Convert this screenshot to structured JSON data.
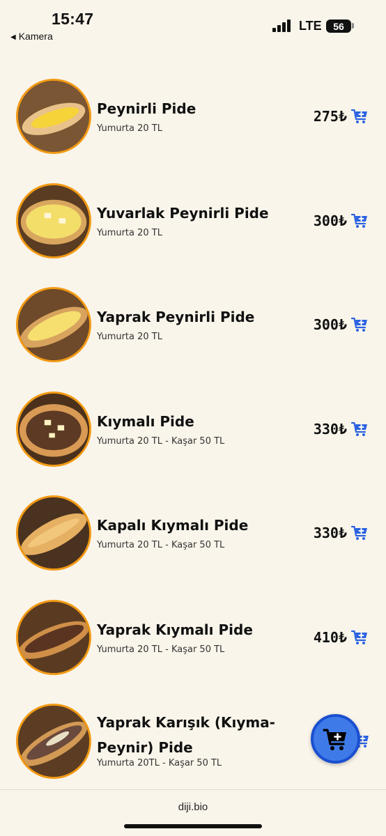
{
  "status_bar": {
    "time": "15:47",
    "back_label": "Kamera",
    "network": "LTE",
    "battery": "56"
  },
  "menu_items": [
    {
      "name": "Peynirli Pide",
      "description": "Yumurta 20 TL",
      "price": "275₺",
      "image": "cheese-pide",
      "cart_icon": "add-to-cart-icon"
    },
    {
      "name": "Yuvarlak Peynirli Pide",
      "description": "Yumurta 20 TL",
      "price": "300₺",
      "image": "round-cheese-pide",
      "cart_icon": "add-to-cart-icon"
    },
    {
      "name": "Yaprak Peynirli Pide",
      "description": "Yumurta 20 TL",
      "price": "300₺",
      "image": "leaf-cheese-pide",
      "cart_icon": "add-to-cart-icon"
    },
    {
      "name": "Kıymalı Pide",
      "description": "Yumurta 20 TL - Kaşar 50 TL",
      "price": "330₺",
      "image": "minced-meat-pide",
      "cart_icon": "add-to-cart-icon"
    },
    {
      "name": "Kapalı Kıymalı Pide",
      "description": "Yumurta 20 TL - Kaşar 50 TL",
      "price": "330₺",
      "image": "closed-minced-meat-pide",
      "cart_icon": "add-to-cart-icon"
    },
    {
      "name": "Yaprak Kıymalı Pide",
      "description": "Yumurta 20 TL - Kaşar 50 TL",
      "price": "410₺",
      "image": "leaf-minced-meat-pide",
      "cart_icon": "add-to-cart-icon"
    },
    {
      "name": "Yaprak Karışık (Kıyma-Peynir) Pide",
      "description": "Yumurta 20TL - Kaşar 50 TL",
      "price": "",
      "image": "mixed-pide",
      "cart_icon": "add-to-cart-icon"
    }
  ],
  "floating_cart": {
    "icon": "cart-icon"
  },
  "bottom_bar": {
    "url": "diji.bio"
  },
  "colors": {
    "background": "#faf5eb",
    "accent_orange": "#f29a14",
    "cart_blue": "#2a62e0"
  }
}
